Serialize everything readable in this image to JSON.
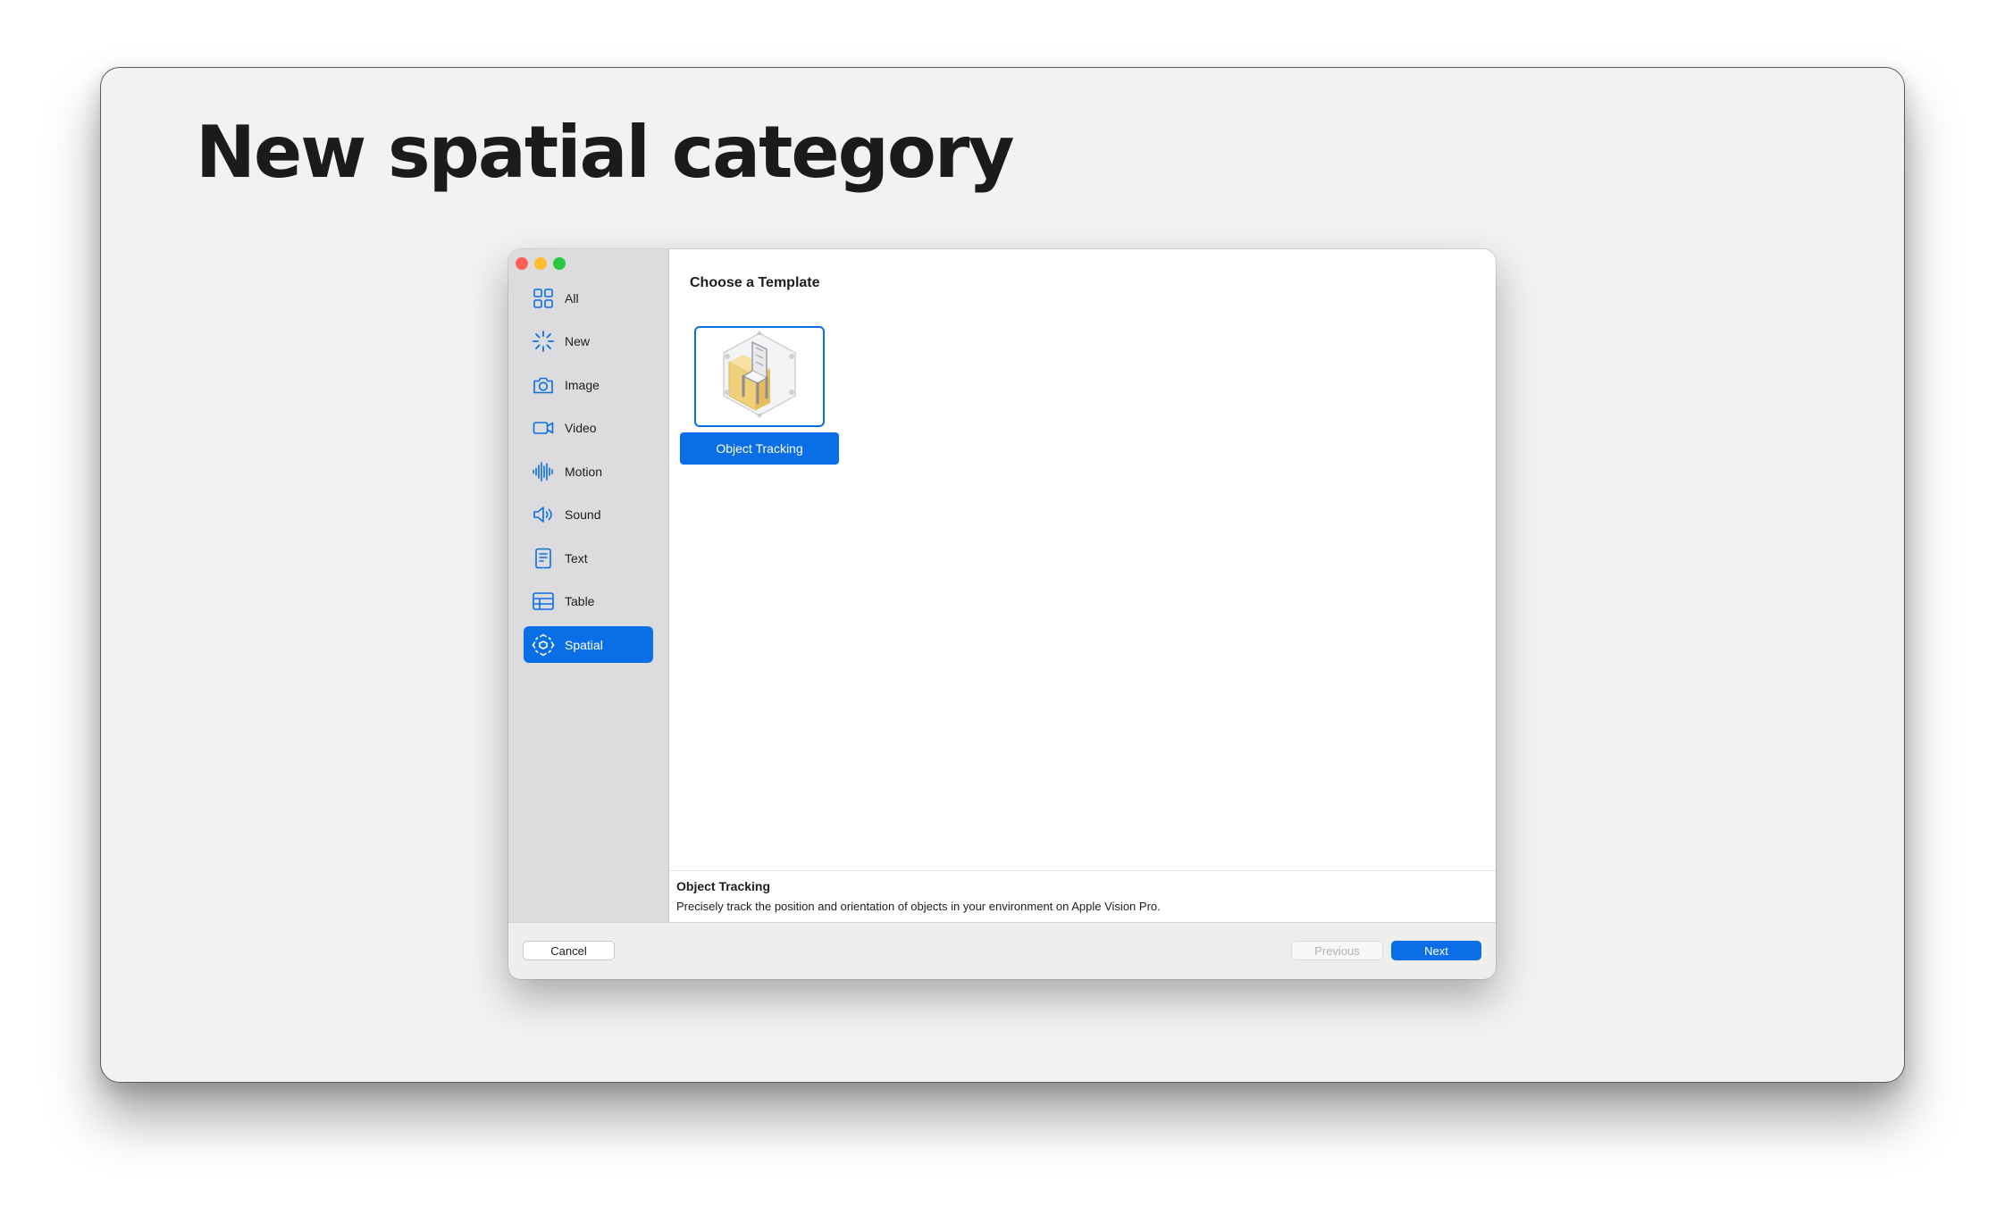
{
  "slide": {
    "title": "New spatial category"
  },
  "sidebar": {
    "items": [
      {
        "label": "All",
        "icon": "grid-icon"
      },
      {
        "label": "New",
        "icon": "sparkle-icon"
      },
      {
        "label": "Image",
        "icon": "camera-icon"
      },
      {
        "label": "Video",
        "icon": "video-camera-icon"
      },
      {
        "label": "Motion",
        "icon": "waveform-icon"
      },
      {
        "label": "Sound",
        "icon": "speaker-icon"
      },
      {
        "label": "Text",
        "icon": "document-icon"
      },
      {
        "label": "Table",
        "icon": "table-icon"
      },
      {
        "label": "Spatial",
        "icon": "spatial-icon",
        "selected": true
      }
    ]
  },
  "main": {
    "title": "Choose a Template",
    "templates": [
      {
        "label": "Object Tracking",
        "icon": "object-tracking-icon",
        "selected": true
      }
    ]
  },
  "description": {
    "title": "Object Tracking",
    "text": "Precisely track the position and orientation of objects in your environment on Apple Vision Pro."
  },
  "footer": {
    "cancel_label": "Cancel",
    "previous_label": "Previous",
    "next_label": "Next"
  },
  "colors": {
    "accent": "#0a6ee6",
    "sidebar_bg": "#dcdcde",
    "slide_bg": "#f2f2f4"
  }
}
